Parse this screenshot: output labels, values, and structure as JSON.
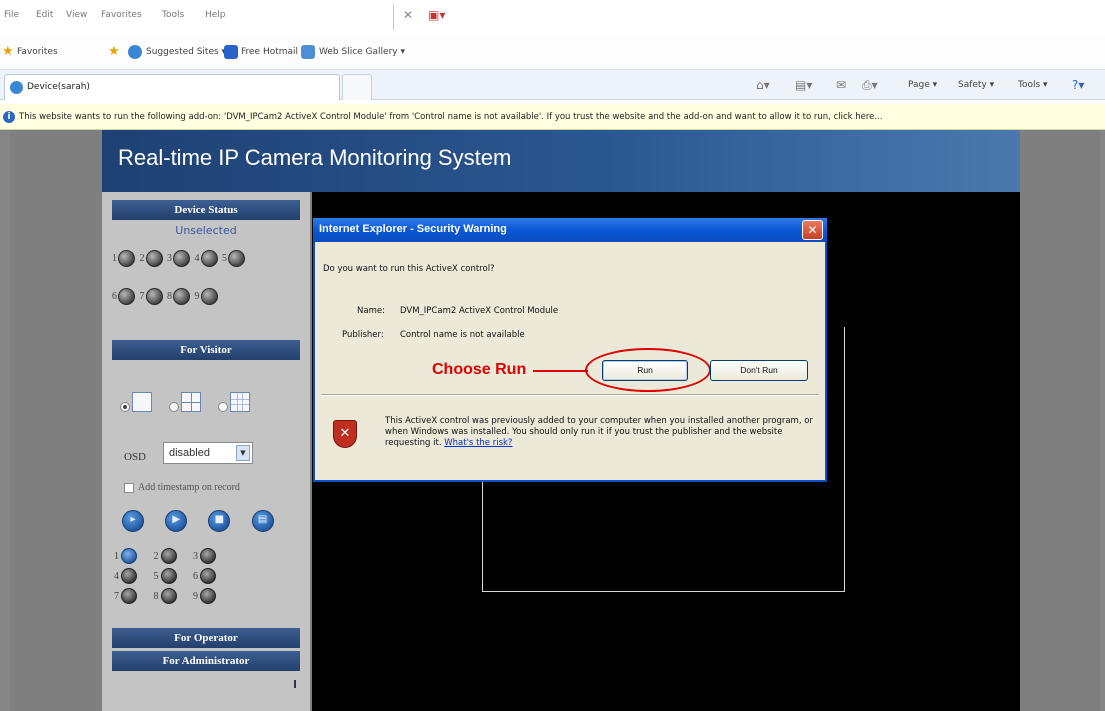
{
  "browser": {
    "menu": [
      "File",
      "Edit",
      "View",
      "Favorites",
      "Tools",
      "Help"
    ],
    "favorites_bar": {
      "favorites_label": "Favorites",
      "links": [
        "Suggested Sites ▾",
        "Free Hotmail",
        "Web Slice Gallery ▾"
      ]
    },
    "tab_label": "Device(sarah)",
    "commands": [
      "Page ▾",
      "Safety ▾",
      "Tools ▾"
    ],
    "infobar_text": "This website wants to run the following add-on: 'DVM_IPCam2 ActiveX Control Module' from 'Control name is not available'. If you trust the website and the add-on and want to allow it to run, click here..."
  },
  "page": {
    "title": "Real-time IP Camera Monitoring System",
    "sidebar": {
      "device_status": "Device Status",
      "unselected": "Unselected",
      "devices_row1": [
        "1",
        "2",
        "3",
        "4",
        "5"
      ],
      "devices_row2": [
        "6",
        "7",
        "8",
        "9"
      ],
      "for_visitor": "For Visitor",
      "osd_label": "OSD",
      "osd_value": "disabled",
      "timestamp_label": "Add timestamp on record",
      "presets": [
        "1",
        "2",
        "3",
        "4",
        "5",
        "6",
        "7",
        "8",
        "9"
      ],
      "for_operator": "For Operator",
      "for_administrator": "For Administrator"
    }
  },
  "dialog": {
    "title": "Internet Explorer - Security Warning",
    "question": "Do you want to run this ActiveX control?",
    "name_label": "Name:",
    "name_value": "DVM_IPCam2 ActiveX Control Module",
    "publisher_label": "Publisher:",
    "publisher_value": "Control name is not available",
    "annotation": "Choose Run",
    "run_button": "Run",
    "dont_run_button": "Don't Run",
    "warning_text": "This ActiveX control was previously added to your computer when you installed another program, or when Windows was installed. You should only run it if you trust the publisher and the website requesting it.",
    "risk_link": "What's the risk?"
  },
  "colors": {
    "dialog_title_blue": "#0b58d6",
    "annotation_red": "#e00000",
    "sidebar_header": "#233f6c",
    "video_background": "#000000"
  }
}
